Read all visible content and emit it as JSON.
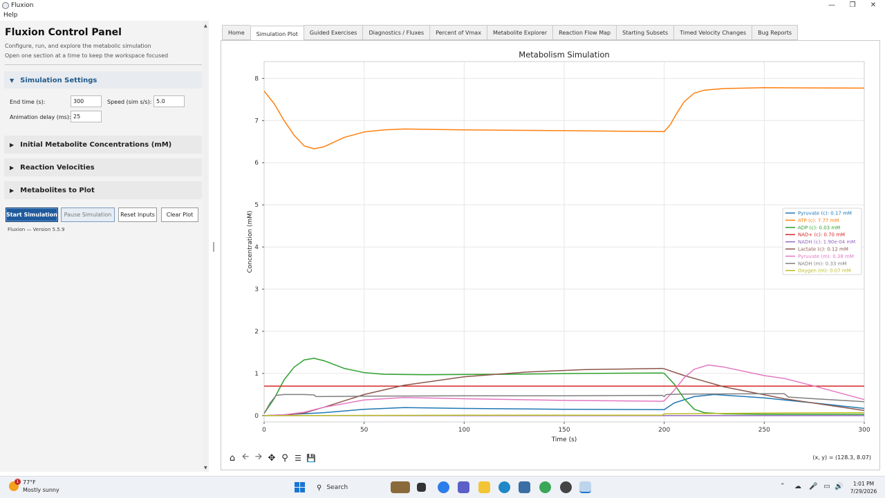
{
  "window": {
    "title": "Fluxion"
  },
  "menu": {
    "help": "Help"
  },
  "left_panel": {
    "title": "Fluxion Control Panel",
    "subtitle_1": "Configure, run, and explore the metabolic simulation",
    "subtitle_2": "Open one section at a time to keep the workspace focused",
    "sections": {
      "simulation_settings": "Simulation Settings",
      "initial_concentrations": "Initial Metabolite Concentrations (mM)",
      "reaction_velocities": "Reaction Velocities",
      "metabolites_to_plot": "Metabolites to Plot"
    },
    "settings": {
      "end_time_label": "End time (s):",
      "end_time_value": "300",
      "speed_label": "Speed (sim s/s):",
      "speed_value": "5.0",
      "animation_delay_label": "Animation delay (ms):",
      "animation_delay_value": "25"
    },
    "buttons": {
      "start": "Start Simulation",
      "pause": "Pause Simulation",
      "reset": "Reset Inputs",
      "clear": "Clear Plot"
    },
    "version": "Fluxion — Version 5.5.9"
  },
  "tabs": [
    {
      "label": "Home",
      "active": false
    },
    {
      "label": "Simulation Plot",
      "active": true
    },
    {
      "label": "Guided Exercises",
      "active": false
    },
    {
      "label": "Diagnostics / Fluxes",
      "active": false
    },
    {
      "label": "Percent of Vmax",
      "active": false
    },
    {
      "label": "Metabolite Explorer",
      "active": false
    },
    {
      "label": "Reaction Flow Map",
      "active": false
    },
    {
      "label": "Starting Subsets",
      "active": false
    },
    {
      "label": "Timed Velocity Changes",
      "active": false
    },
    {
      "label": "Bug Reports",
      "active": false
    }
  ],
  "chart_data": {
    "type": "line",
    "title": "Metabolism Simulation",
    "xlabel": "Time (s)",
    "ylabel": "Concentration (mM)",
    "xlim": [
      0,
      300
    ],
    "ylim": [
      -0.15,
      8.4
    ],
    "xticks": [
      "0",
      "50",
      "100",
      "150",
      "200",
      "250",
      "300"
    ],
    "yticks": [
      "0",
      "1",
      "2",
      "3",
      "4",
      "5",
      "6",
      "7",
      "8"
    ],
    "grid": true,
    "legend_position": "center-right",
    "series": [
      {
        "name": "Pyruvate (c): 0.17 mM",
        "color": "#1f77b4",
        "x": [
          0,
          10,
          30,
          50,
          70,
          100,
          150,
          199,
          200,
          205,
          215,
          225,
          250,
          275,
          300
        ],
        "y": [
          0,
          0.02,
          0.07,
          0.15,
          0.19,
          0.17,
          0.15,
          0.14,
          0.14,
          0.3,
          0.45,
          0.5,
          0.42,
          0.3,
          0.17
        ]
      },
      {
        "name": "ATP (c): 7.77 mM",
        "color": "#ff7f0e",
        "x": [
          0,
          5,
          10,
          15,
          20,
          25,
          30,
          40,
          50,
          60,
          70,
          100,
          150,
          199,
          200,
          203,
          206,
          210,
          215,
          220,
          230,
          250,
          300
        ],
        "y": [
          7.7,
          7.4,
          7.0,
          6.65,
          6.4,
          6.33,
          6.38,
          6.6,
          6.73,
          6.78,
          6.8,
          6.78,
          6.76,
          6.74,
          6.74,
          6.9,
          7.15,
          7.45,
          7.65,
          7.72,
          7.76,
          7.78,
          7.77
        ]
      },
      {
        "name": "ADP (c): 0.03 mM",
        "color": "#2ca02c",
        "x": [
          0,
          5,
          10,
          15,
          20,
          25,
          30,
          40,
          50,
          60,
          80,
          120,
          160,
          199,
          200,
          205,
          210,
          215,
          220,
          230,
          250,
          300
        ],
        "y": [
          0.05,
          0.4,
          0.85,
          1.15,
          1.32,
          1.36,
          1.3,
          1.12,
          1.02,
          0.98,
          0.97,
          0.98,
          1.0,
          1.01,
          1.0,
          0.75,
          0.4,
          0.15,
          0.07,
          0.04,
          0.03,
          0.03
        ]
      },
      {
        "name": "NAD+ (c): 0.70 mM",
        "color": "#d62728",
        "x": [
          0,
          300
        ],
        "y": [
          0.7,
          0.7
        ]
      },
      {
        "name": "NADH (c): 1.90e-04 mM",
        "color": "#9467bd",
        "x": [
          0,
          300
        ],
        "y": [
          0.0,
          0.0
        ]
      },
      {
        "name": "Lactate (c): 0.12 mM",
        "color": "#8c564b",
        "x": [
          0,
          10,
          20,
          30,
          50,
          70,
          100,
          130,
          160,
          199,
          200,
          210,
          230,
          260,
          300
        ],
        "y": [
          0,
          0.01,
          0.06,
          0.2,
          0.5,
          0.72,
          0.92,
          1.03,
          1.09,
          1.12,
          1.11,
          0.95,
          0.68,
          0.4,
          0.12
        ]
      },
      {
        "name": "Pyruvate (m): 0.38 mM",
        "color": "#e377c2",
        "x": [
          0,
          10,
          20,
          30,
          50,
          70,
          100,
          150,
          199,
          200,
          205,
          210,
          215,
          222,
          230,
          250,
          260,
          275,
          300
        ],
        "y": [
          0,
          0.02,
          0.08,
          0.2,
          0.37,
          0.43,
          0.4,
          0.36,
          0.34,
          0.35,
          0.6,
          0.9,
          1.1,
          1.2,
          1.15,
          0.95,
          0.88,
          0.7,
          0.38
        ]
      },
      {
        "name": "NADH (m): 0.33 mM",
        "color": "#7f7f7f",
        "x": [
          0,
          3,
          6,
          10,
          20,
          25,
          26,
          50,
          100,
          150,
          199,
          200,
          201,
          210,
          250,
          260,
          262,
          275,
          300
        ],
        "y": [
          0.05,
          0.3,
          0.48,
          0.5,
          0.5,
          0.49,
          0.45,
          0.46,
          0.47,
          0.47,
          0.48,
          0.45,
          0.5,
          0.51,
          0.52,
          0.52,
          0.44,
          0.4,
          0.33
        ]
      },
      {
        "name": "Oxygen (m): 0.07 mM",
        "color": "#bcbd22",
        "x": [
          0,
          100,
          199,
          200,
          250,
          300
        ],
        "y": [
          0.0,
          0.01,
          0.01,
          0.04,
          0.06,
          0.07
        ]
      }
    ]
  },
  "toolbar": {
    "tools": [
      "home-icon",
      "back-arrow-icon",
      "forward-arrow-icon",
      "pan-icon",
      "zoom-icon",
      "configure-subplots-icon",
      "save-icon"
    ],
    "coordinates": "(x, y) = (128.3, 8.07)"
  },
  "taskbar": {
    "weather_temp": "77°F",
    "weather_desc": "Mostly sunny",
    "weather_badge": "1",
    "search_label": "Search",
    "time": "1:01 PM",
    "date": "7/29/2026"
  }
}
